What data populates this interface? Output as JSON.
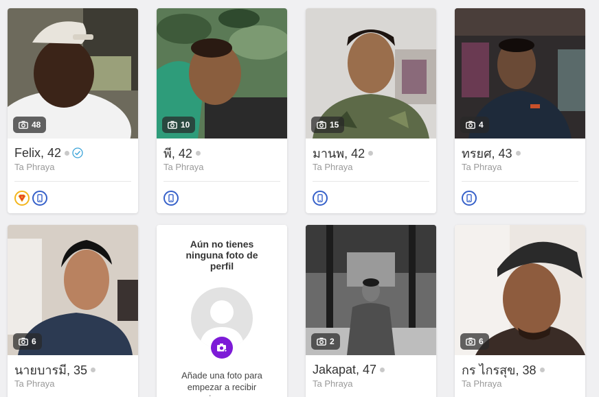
{
  "profiles": [
    {
      "name": "Felix, 42",
      "location": "Ta Phraya",
      "photo_count": "48",
      "verified": true,
      "badges": [
        "superhero-badge",
        "phone-badge"
      ]
    },
    {
      "name": "พี, 42",
      "location": "Ta Phraya",
      "photo_count": "10",
      "verified": false,
      "badges": [
        "phone-badge"
      ]
    },
    {
      "name": "มานพ, 42",
      "location": "Ta Phraya",
      "photo_count": "15",
      "verified": false,
      "badges": [
        "phone-badge"
      ]
    },
    {
      "name": "ทรยศ, 43",
      "location": "Ta Phraya",
      "photo_count": "4",
      "verified": false,
      "badges": [
        "phone-badge"
      ]
    },
    {
      "name": "นายบารมี, 35",
      "location": "Ta Phraya",
      "photo_count": "6"
    },
    {
      "name": "Jakapat, 47",
      "location": "Ta Phraya",
      "photo_count": "2"
    },
    {
      "name": "กร ไกรสุข, 38",
      "location": "Ta Phraya",
      "photo_count": "6"
    }
  ],
  "no_photo_card": {
    "title": "Aún no tienes ninguna foto de perfil",
    "description": "Añade una foto para empezar a recibir mensajes y conocer"
  },
  "colors": {
    "accent_purple": "#7d1bd7",
    "badge_blue": "#3560c9",
    "verified_blue": "#3aa3d8",
    "hero_yellow": "#f3b51b"
  }
}
